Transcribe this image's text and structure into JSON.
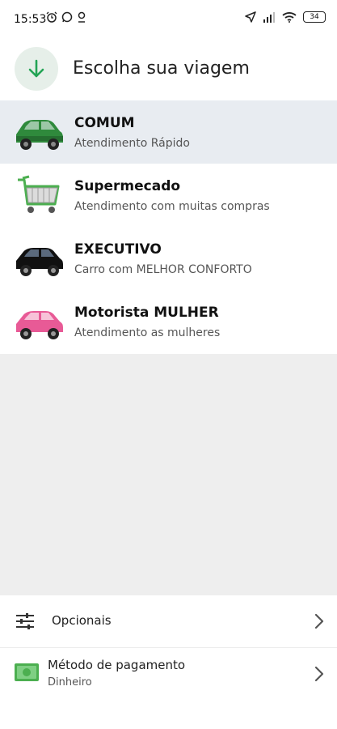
{
  "status_bar": {
    "time": "15:53",
    "battery": "34"
  },
  "header": {
    "title": "Escolha sua viagem",
    "icon": "arrow-down-icon",
    "accent": "#23a455"
  },
  "options": [
    {
      "name": "COMUM",
      "description": "Atendimento Rápido",
      "icon": "green-car-icon",
      "color": "#2f8a3c",
      "selected": true
    },
    {
      "name": "Supermecado",
      "description": "Atendimento com muitas compras",
      "icon": "shopping-cart-icon",
      "color": "#4caf50",
      "selected": false
    },
    {
      "name": "EXECUTIVO",
      "description": "Carro com MELHOR CONFORTO",
      "icon": "black-car-icon",
      "color": "#111111",
      "selected": false
    },
    {
      "name": "Motorista MULHER",
      "description": "Atendimento as mulheres",
      "icon": "pink-car-icon",
      "color": "#e85a96",
      "selected": false
    }
  ],
  "footer": {
    "optionals_label": "Opcionais",
    "payment_label": "Método de pagamento",
    "payment_value": "Dinheiro"
  }
}
